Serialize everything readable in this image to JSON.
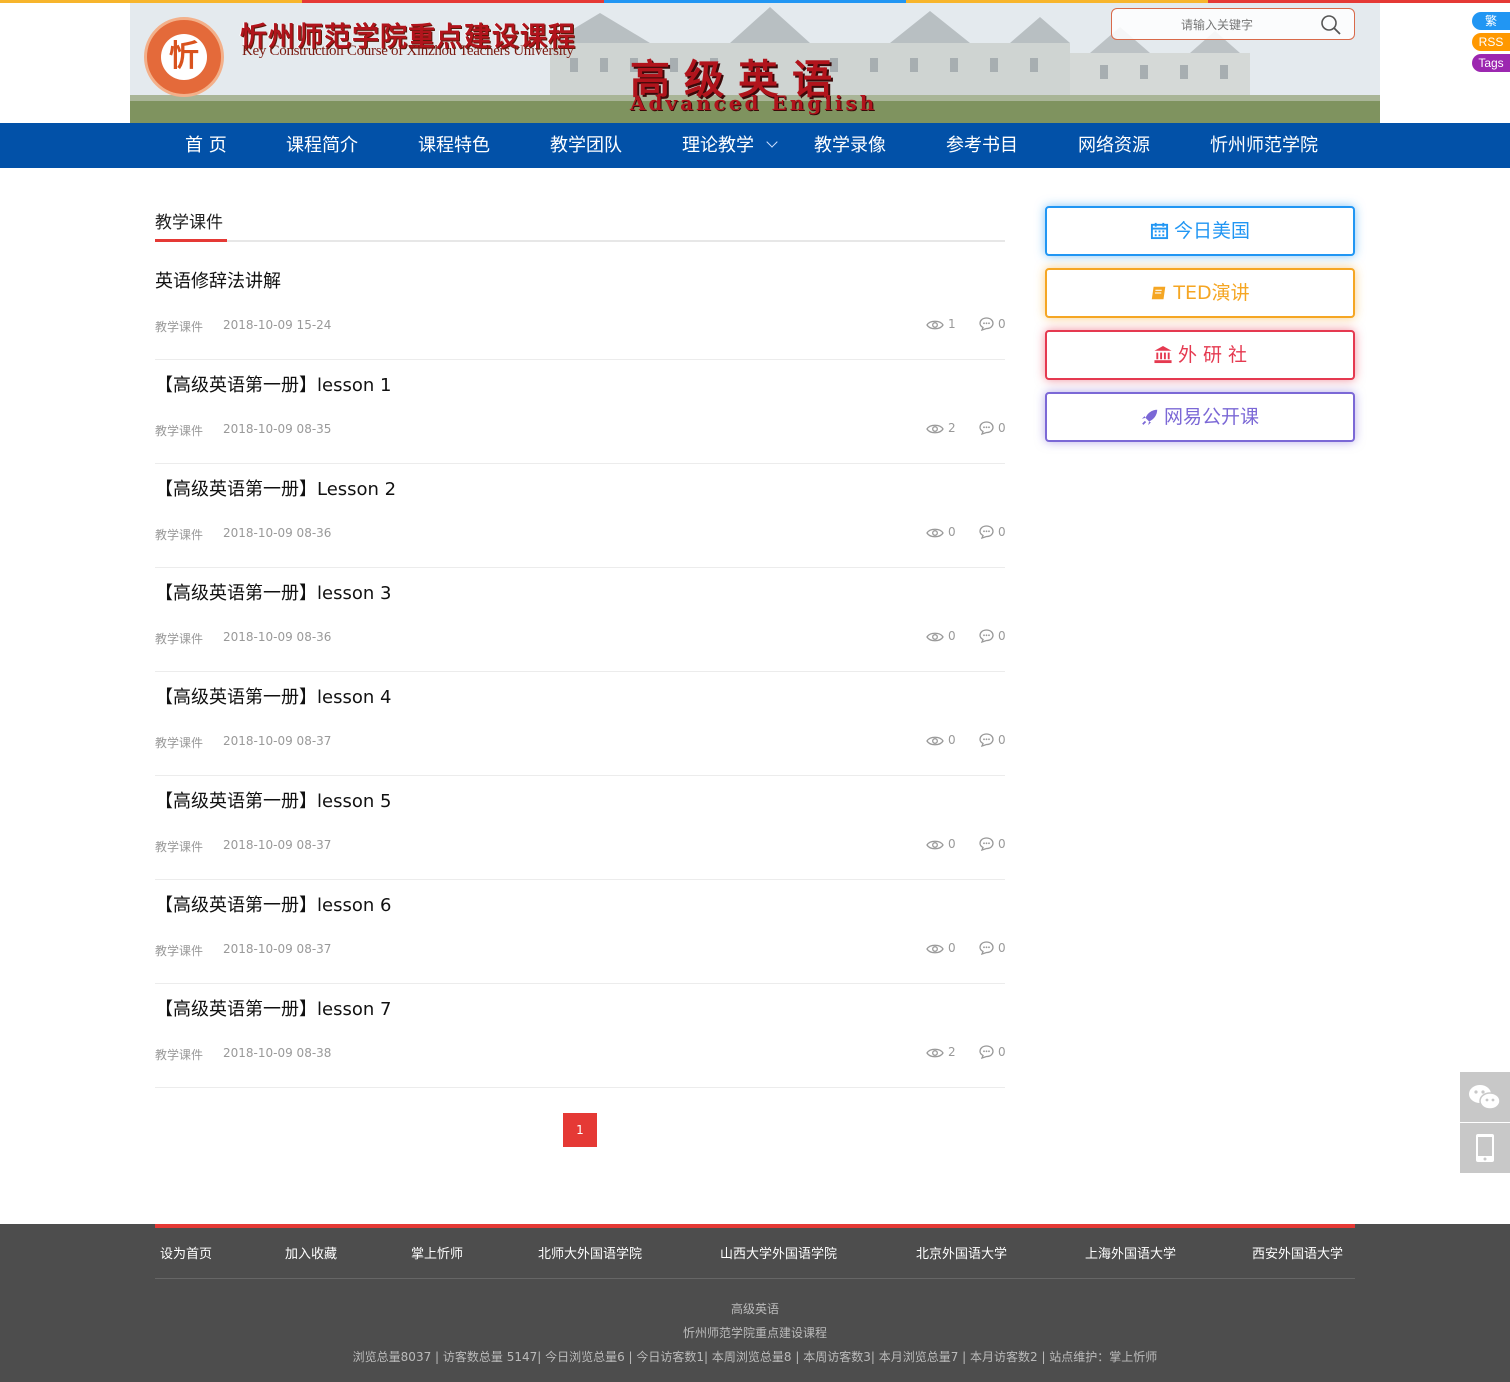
{
  "top_strip_colors": [
    "#f7b52c",
    "#e53935",
    "#2196f3",
    "#f7b52c",
    "#e53935"
  ],
  "banner": {
    "seal_char": "忻",
    "cn_title": "忻州师范学院重点建设课程",
    "en_title": "Key Construction Course of Xinzhou Teachers University",
    "course_title": "高级英语",
    "course_title_en": "Advanced English"
  },
  "search": {
    "placeholder": "请输入关键字",
    "icon": "search-icon"
  },
  "side_badges": [
    {
      "label": "繁",
      "color": "#2196f3"
    },
    {
      "label": "RSS",
      "color": "#ff9800"
    },
    {
      "label": "Tags",
      "color": "#9c27b0"
    }
  ],
  "nav": {
    "items": [
      {
        "label": "首 页"
      },
      {
        "label": "课程简介"
      },
      {
        "label": "课程特色"
      },
      {
        "label": "教学团队"
      },
      {
        "label": "理论教学",
        "has_dropdown": true
      },
      {
        "label": "教学录像"
      },
      {
        "label": "参考书目"
      },
      {
        "label": "网络资源"
      },
      {
        "label": "忻州师范学院"
      }
    ]
  },
  "main": {
    "section_title": "教学课件",
    "posts": [
      {
        "title": "英语修辞法讲解",
        "category": "教学课件",
        "date": "2018-10-09 15-24",
        "views": "1",
        "comments": "0"
      },
      {
        "title": "【高级英语第一册】lesson 1",
        "category": "教学课件",
        "date": "2018-10-09 08-35",
        "views": "2",
        "comments": "0"
      },
      {
        "title": "【高级英语第一册】Lesson 2",
        "category": "教学课件",
        "date": "2018-10-09 08-36",
        "views": "0",
        "comments": "0"
      },
      {
        "title": "【高级英语第一册】lesson 3",
        "category": "教学课件",
        "date": "2018-10-09 08-36",
        "views": "0",
        "comments": "0"
      },
      {
        "title": "【高级英语第一册】lesson 4",
        "category": "教学课件",
        "date": "2018-10-09 08-37",
        "views": "0",
        "comments": "0"
      },
      {
        "title": "【高级英语第一册】lesson 5",
        "category": "教学课件",
        "date": "2018-10-09 08-37",
        "views": "0",
        "comments": "0"
      },
      {
        "title": "【高级英语第一册】lesson 6",
        "category": "教学课件",
        "date": "2018-10-09 08-37",
        "views": "0",
        "comments": "0"
      },
      {
        "title": "【高级英语第一册】lesson 7",
        "category": "教学课件",
        "date": "2018-10-09 08-38",
        "views": "2",
        "comments": "0"
      }
    ],
    "pagination": {
      "current": "1"
    }
  },
  "sidebar": {
    "buttons": [
      {
        "label": "今日美国",
        "icon": "calendar-icon",
        "color": "#2196f3"
      },
      {
        "label": "TED演讲",
        "icon": "book-icon",
        "color": "#f5a623"
      },
      {
        "label": "外 研 社",
        "icon": "bank-icon",
        "color": "#e53950"
      },
      {
        "label": "网易公开课",
        "icon": "rocket-icon",
        "color": "#7b68d6"
      }
    ]
  },
  "floating_tools": [
    {
      "icon": "wechat-icon"
    },
    {
      "icon": "mobile-icon"
    }
  ],
  "footer": {
    "accent_color": "#e53935",
    "links": [
      {
        "label": "设为首页"
      },
      {
        "label": "加入收藏"
      },
      {
        "label": "掌上忻师"
      },
      {
        "label": "北师大外国语学院"
      },
      {
        "label": "山西大学外国语学院"
      },
      {
        "label": "北京外国语大学"
      },
      {
        "label": "上海外国语大学"
      },
      {
        "label": "西安外国语大学"
      }
    ],
    "site_name": "高级英语",
    "subtitle": "忻州师范学院重点建设课程",
    "stats": "浏览总量8037 | 访客数总量 5147| 今日浏览总量6 | 今日访客数1| 本周浏览总量8 | 本周访客数3| 本月浏览总量7 | 本月访客数2 | 站点维护：掌上忻师"
  }
}
